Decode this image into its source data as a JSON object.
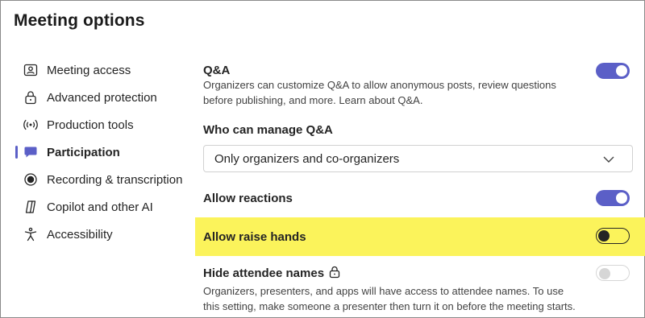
{
  "page": {
    "title": "Meeting options"
  },
  "sidebar": {
    "items": [
      {
        "label": "Meeting access",
        "icon": "person-card-icon",
        "active": false
      },
      {
        "label": "Advanced protection",
        "icon": "lock-icon",
        "active": false
      },
      {
        "label": "Production tools",
        "icon": "broadcast-icon",
        "active": false
      },
      {
        "label": "Participation",
        "icon": "chat-icon",
        "active": true
      },
      {
        "label": "Recording & transcription",
        "icon": "record-icon",
        "active": false
      },
      {
        "label": "Copilot and other AI",
        "icon": "copilot-icon",
        "active": false
      },
      {
        "label": "Accessibility",
        "icon": "accessibility-icon",
        "active": false
      }
    ]
  },
  "main": {
    "qa": {
      "title": "Q&A",
      "description": "Organizers can customize Q&A to allow anonymous posts, review questions before publishing, and more. Learn about Q&A.",
      "enabled": true
    },
    "manage_qa": {
      "title": "Who can manage Q&A",
      "selected": "Only organizers and co-organizers"
    },
    "reactions": {
      "title": "Allow reactions",
      "enabled": true
    },
    "raise_hands": {
      "title": "Allow raise hands",
      "enabled": false,
      "highlighted": true
    },
    "hide_names": {
      "title": "Hide attendee names",
      "description": "Organizers, presenters, and apps will have access to attendee names. To use this setting, make someone a presenter then turn it on before the meeting starts.",
      "enabled": false,
      "disabled": true
    }
  },
  "colors": {
    "accent": "#5b5fc7",
    "highlight": "#fbf35b"
  }
}
